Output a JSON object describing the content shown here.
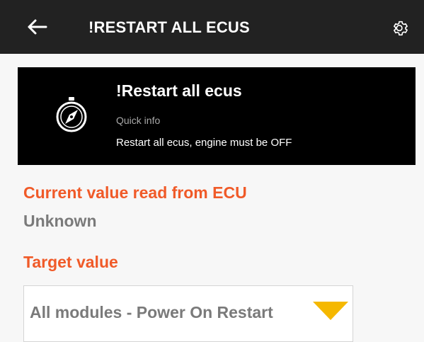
{
  "app_bar": {
    "title": "!RESTART ALL ECUS",
    "back_icon": "arrow-left-icon",
    "settings_icon": "gear-icon"
  },
  "info_card": {
    "icon": "compass-icon",
    "title": "!Restart all ecus",
    "subtitle": "Quick info",
    "description": "Restart all ecus, engine must be OFF"
  },
  "current": {
    "label": "Current value read from ECU",
    "value": "Unknown"
  },
  "target": {
    "label": "Target value",
    "selected": "All modules - Power On Restart",
    "arrow_icon": "dropdown-triangle-icon"
  },
  "colors": {
    "app_bar_bg": "#222222",
    "card_bg": "#000000",
    "accent": "#f05a28",
    "muted_text": "#7a7a7a",
    "dropdown_arrow": "#f5b800",
    "background": "#f7f7f7"
  }
}
